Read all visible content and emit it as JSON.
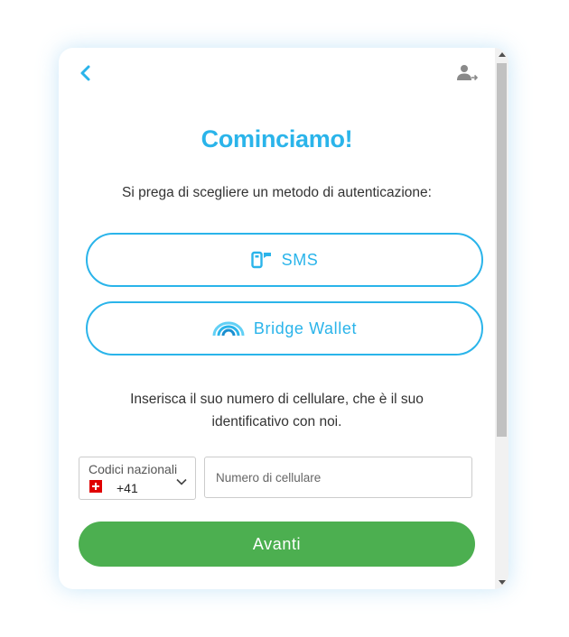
{
  "header": {
    "back_icon": "chevron-left-icon",
    "user_icon": "user-add-icon"
  },
  "title": "Cominciamo!",
  "subtitle": "Si prega di scegliere un metodo di autenticazione:",
  "methods": [
    {
      "label": "SMS",
      "icon": "mobile-phone-icon"
    },
    {
      "label": "Bridge Wallet",
      "icon": "rainbow-arcs-icon"
    }
  ],
  "info_text": "Inserisca il suo numero di cellulare, che è il suo identificativo con noi.",
  "country_select": {
    "label": "Codici nazionali",
    "value": "+41",
    "flag": "switzerland-flag"
  },
  "phone_input": {
    "placeholder": "Numero di cellulare",
    "value": ""
  },
  "next_button": "Avanti",
  "colors": {
    "accent": "#2ab4ea",
    "primary_button": "#4caf50"
  }
}
